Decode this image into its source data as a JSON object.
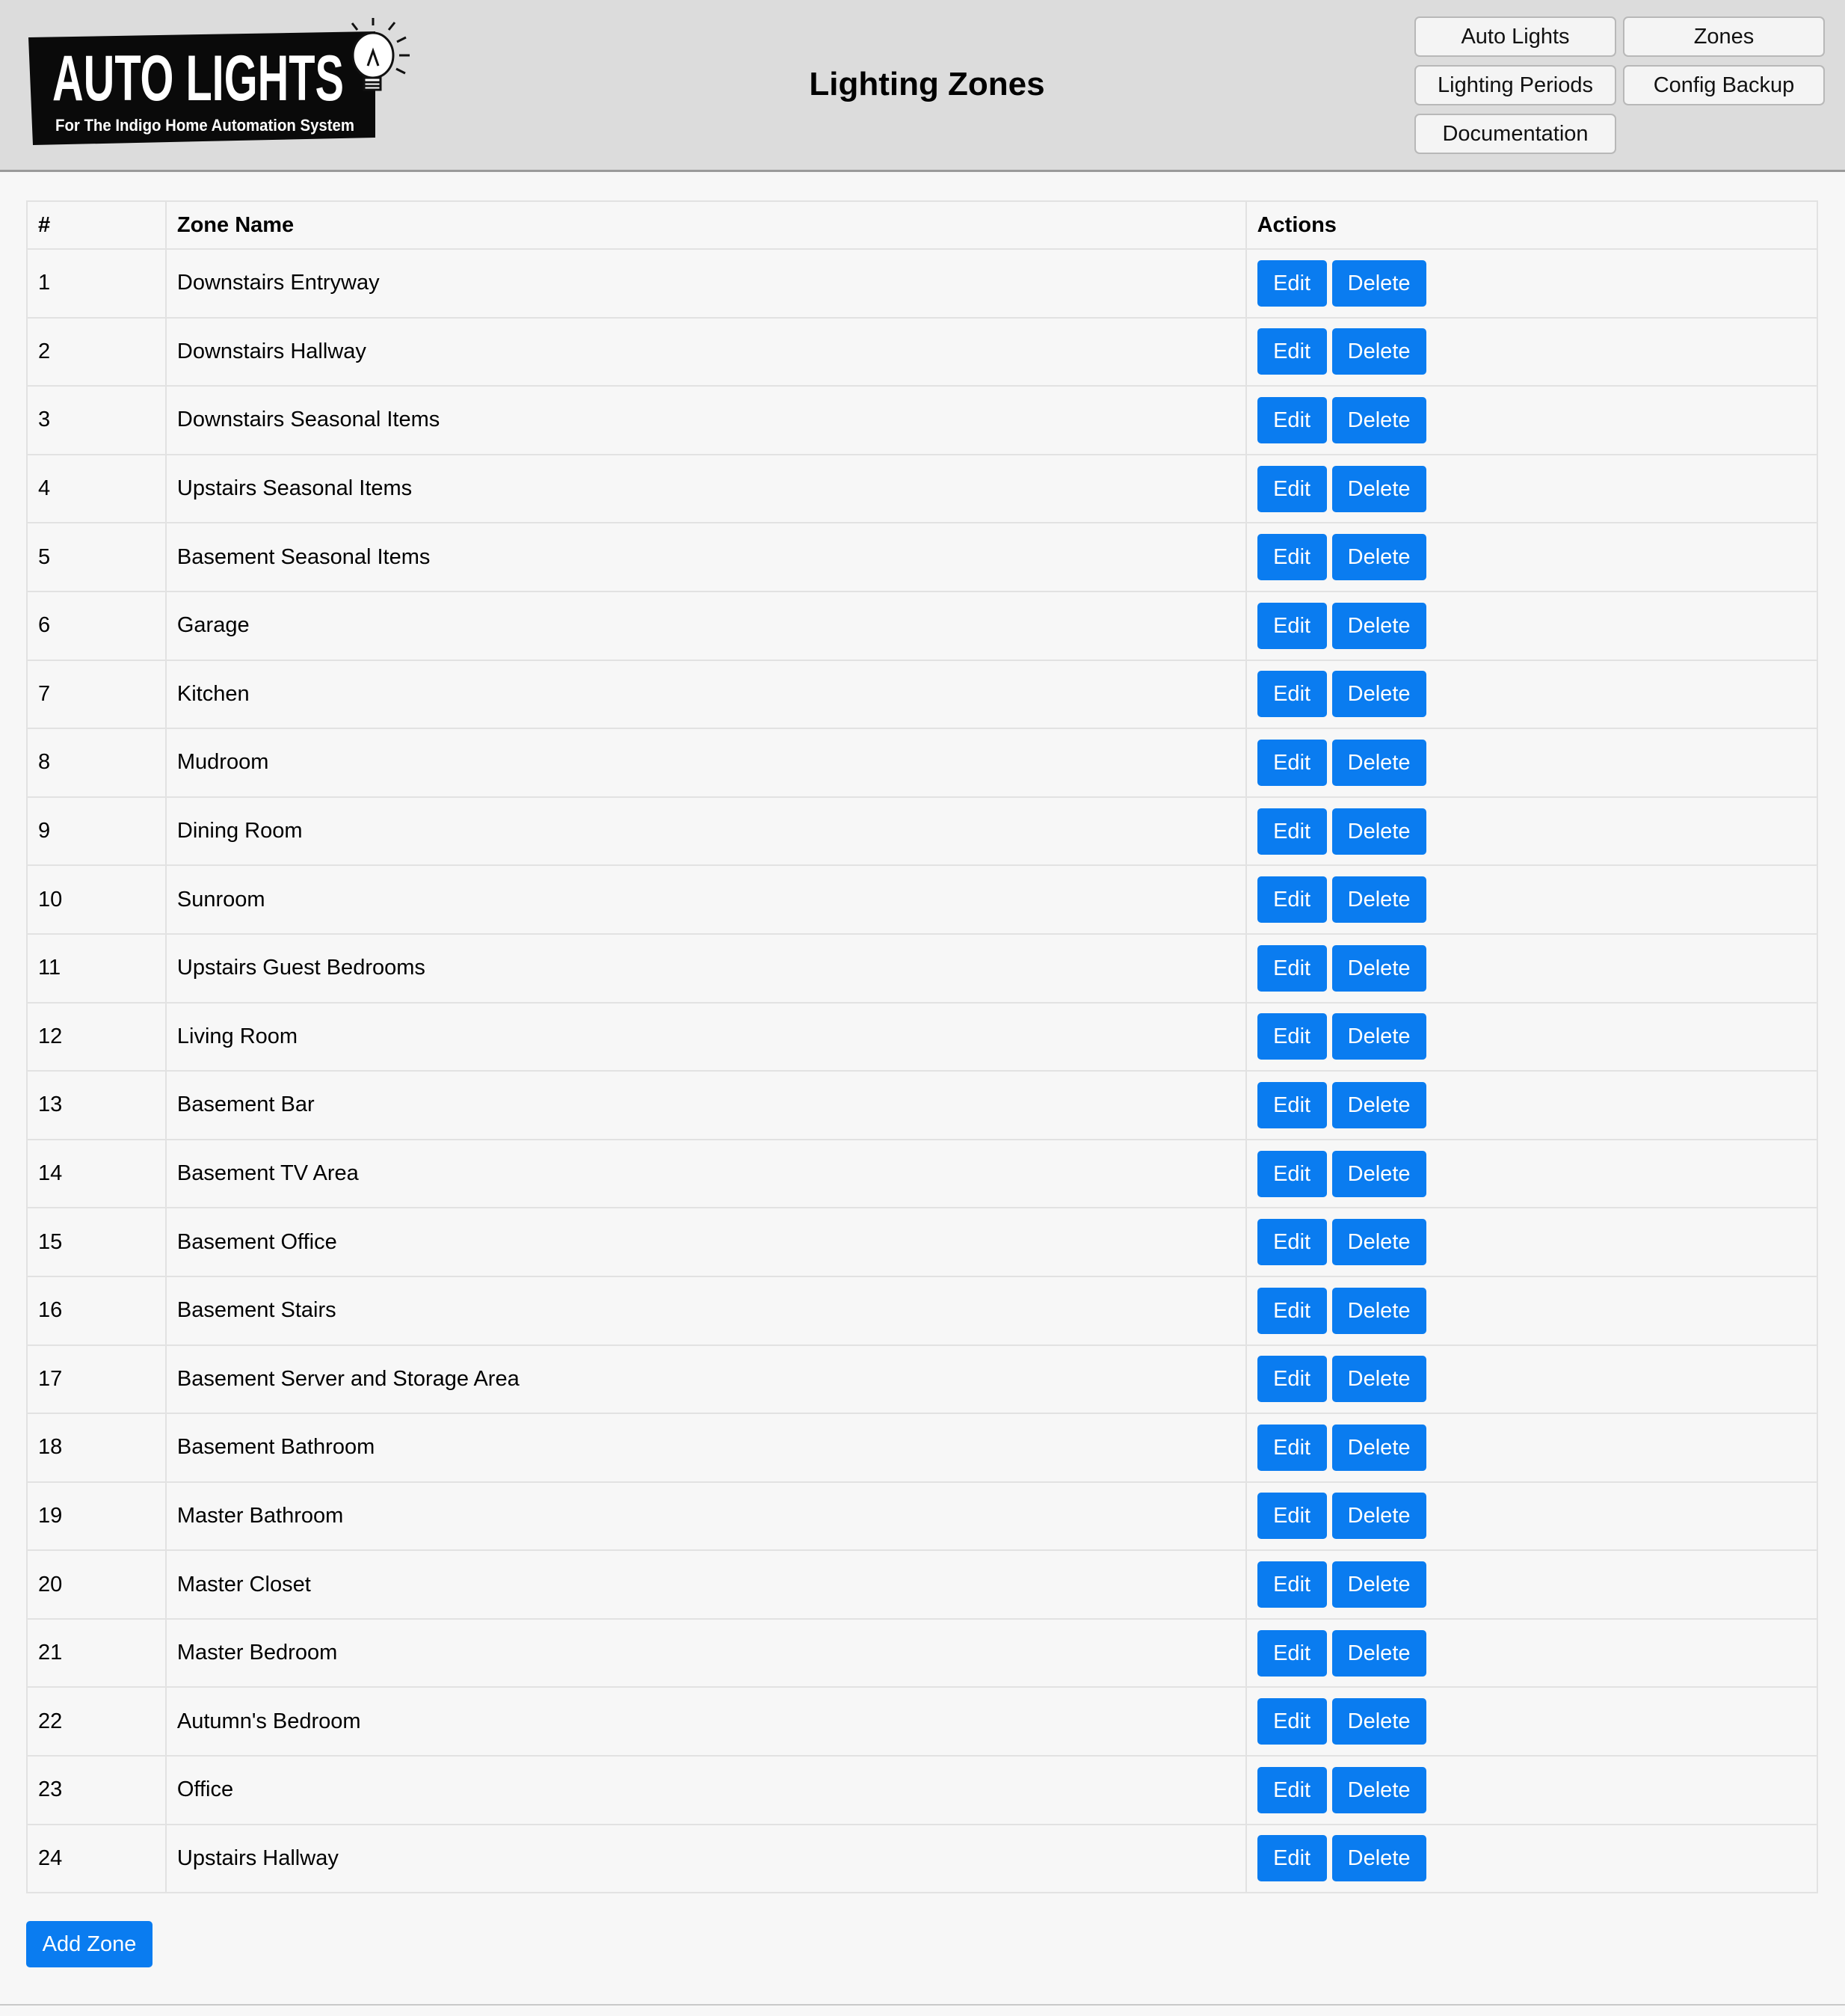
{
  "brand": {
    "logo_text": "AUTO LIGHTS",
    "logo_tagline": "For The Indigo Home Automation System"
  },
  "header": {
    "title": "Lighting Zones",
    "nav": [
      {
        "label": "Auto Lights"
      },
      {
        "label": "Zones"
      },
      {
        "label": "Lighting Periods"
      },
      {
        "label": "Config Backup"
      },
      {
        "label": "Documentation"
      }
    ]
  },
  "table": {
    "headers": {
      "num": "#",
      "name": "Zone Name",
      "actions": "Actions"
    },
    "edit_label": "Edit",
    "delete_label": "Delete",
    "rows": [
      {
        "num": "1",
        "name": "Downstairs Entryway"
      },
      {
        "num": "2",
        "name": "Downstairs Hallway"
      },
      {
        "num": "3",
        "name": "Downstairs Seasonal Items"
      },
      {
        "num": "4",
        "name": "Upstairs Seasonal Items"
      },
      {
        "num": "5",
        "name": "Basement Seasonal Items"
      },
      {
        "num": "6",
        "name": "Garage"
      },
      {
        "num": "7",
        "name": "Kitchen"
      },
      {
        "num": "8",
        "name": "Mudroom"
      },
      {
        "num": "9",
        "name": "Dining Room"
      },
      {
        "num": "10",
        "name": "Sunroom"
      },
      {
        "num": "11",
        "name": "Upstairs Guest Bedrooms"
      },
      {
        "num": "12",
        "name": "Living Room"
      },
      {
        "num": "13",
        "name": "Basement Bar"
      },
      {
        "num": "14",
        "name": "Basement TV Area"
      },
      {
        "num": "15",
        "name": "Basement Office"
      },
      {
        "num": "16",
        "name": "Basement Stairs"
      },
      {
        "num": "17",
        "name": "Basement Server and Storage Area"
      },
      {
        "num": "18",
        "name": "Basement Bathroom"
      },
      {
        "num": "19",
        "name": "Master Bathroom"
      },
      {
        "num": "20",
        "name": "Master Closet"
      },
      {
        "num": "21",
        "name": "Master Bedroom"
      },
      {
        "num": "22",
        "name": "Autumn's Bedroom"
      },
      {
        "num": "23",
        "name": "Office"
      },
      {
        "num": "24",
        "name": "Upstairs Hallway"
      }
    ]
  },
  "add_zone_label": "Add Zone",
  "colors": {
    "accent": "#0a7cf0",
    "header_bg": "#dcdcdc",
    "page_bg": "#f7f7f7"
  }
}
